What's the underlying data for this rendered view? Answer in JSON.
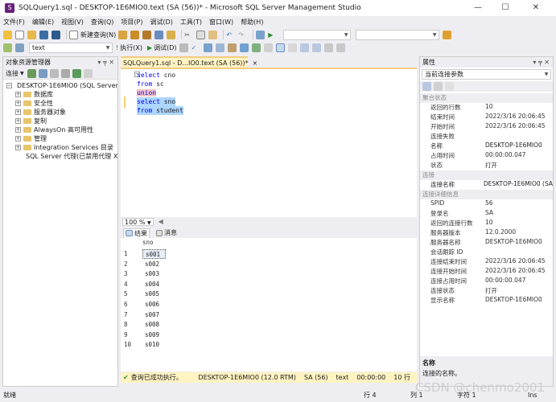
{
  "window": {
    "title": "SQLQuery1.sql - DESKTOP-1E6MIO0.text (SA (56))* - Microsoft SQL Server Management Studio"
  },
  "menu": [
    "文件(F)",
    "编辑(E)",
    "视图(V)",
    "查询(Q)",
    "项目(P)",
    "调试(D)",
    "工具(T)",
    "窗口(W)",
    "帮助(H)"
  ],
  "toolbar1": {
    "new_query": "新建查询(N)"
  },
  "toolbar2": {
    "database": "text",
    "execute": "执行(X)",
    "debug": "调试(D)"
  },
  "object_explorer": {
    "title": "对象资源管理器",
    "connect": "连接",
    "nodes": [
      {
        "label": "DESKTOP-1E6MIO0 (SQL Server"
      },
      {
        "label": "数据库"
      },
      {
        "label": "安全性"
      },
      {
        "label": "服务器对象"
      },
      {
        "label": "复制"
      },
      {
        "label": "AlwaysOn 高可用性"
      },
      {
        "label": "管理"
      },
      {
        "label": "Integration Services 目录"
      },
      {
        "label": "SQL Server 代理(已禁用代理 X"
      }
    ]
  },
  "doc_tab": {
    "label": "SQLQuery1.sql - D...IO0.text (SA (56))*",
    "close": "×"
  },
  "editor": {
    "lines": [
      {
        "kw": "select",
        "rest": " cno"
      },
      {
        "kw": "from",
        "rest": " sc"
      },
      {
        "kw": "union",
        "rest": ""
      },
      {
        "kw": "select",
        "rest": " sno"
      },
      {
        "kw": "from",
        "rest": " student"
      }
    ]
  },
  "zoom": "100 %",
  "results": {
    "tabs": [
      "结果",
      "消息"
    ],
    "column": "sno",
    "rows": [
      {
        "n": "1",
        "v": "s001"
      },
      {
        "n": "2",
        "v": "s002"
      },
      {
        "n": "3",
        "v": "s003"
      },
      {
        "n": "4",
        "v": "s004"
      },
      {
        "n": "5",
        "v": "s005"
      },
      {
        "n": "6",
        "v": "s006"
      },
      {
        "n": "7",
        "v": "s007"
      },
      {
        "n": "8",
        "v": "s008"
      },
      {
        "n": "9",
        "v": "s009"
      },
      {
        "n": "10",
        "v": "s010"
      }
    ]
  },
  "query_status": {
    "message": "查询已成功执行。",
    "server": "DESKTOP-1E6MIO0 (12.0 RTM)",
    "user": "SA (56)",
    "db": "text",
    "time": "00:00:00",
    "rows": "10 行"
  },
  "properties": {
    "title": "属性",
    "selected": "当前连接参数",
    "rows": [
      {
        "k": "聚合状态",
        "v": "",
        "cat": true
      },
      {
        "k": "返回的行数",
        "v": "10"
      },
      {
        "k": "结束时间",
        "v": "2022/3/16 20:06:45"
      },
      {
        "k": "开始时间",
        "v": "2022/3/16 20:06:45"
      },
      {
        "k": "连接失败",
        "v": ""
      },
      {
        "k": "名称",
        "v": "DESKTOP-1E6MIO0",
        "hl": true
      },
      {
        "k": "占用时间",
        "v": "00:00:00.047"
      },
      {
        "k": "状态",
        "v": "打开"
      },
      {
        "k": "连接",
        "v": "",
        "cat": true
      },
      {
        "k": "连接名称",
        "v": "DESKTOP-1E6MIO0 (SA",
        "hl": true
      },
      {
        "k": "连接详细信息",
        "v": "",
        "cat": true
      },
      {
        "k": "SPID",
        "v": "56"
      },
      {
        "k": "登录名",
        "v": "SA"
      },
      {
        "k": "返回的连接行数",
        "v": "10"
      },
      {
        "k": "服务器版本",
        "v": "12.0.2000"
      },
      {
        "k": "服务器名称",
        "v": "DESKTOP-1E6MIO0"
      },
      {
        "k": "会话跟踪 ID",
        "v": ""
      },
      {
        "k": "连接结束时间",
        "v": "2022/3/16 20:06:45"
      },
      {
        "k": "连接开始时间",
        "v": "2022/3/16 20:06:45"
      },
      {
        "k": "连接占用时间",
        "v": "00:00:00.047"
      },
      {
        "k": "连接状态",
        "v": "打开"
      },
      {
        "k": "显示名称",
        "v": "DESKTOP-1E6MIO0"
      }
    ],
    "desc_title": "名称",
    "desc_text": "连接的名称。"
  },
  "statusbar": {
    "ready": "就绪",
    "line": "行 4",
    "col": "列 1",
    "ch": "字符 1",
    "ins": "Ins"
  },
  "watermark": "CSDN @chenmo2001"
}
